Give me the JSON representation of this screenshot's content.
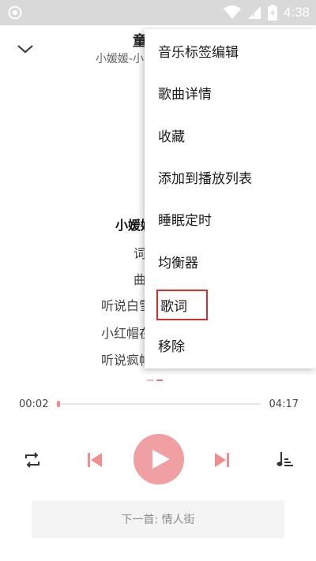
{
  "status_bar": {
    "time": "4:38"
  },
  "player": {
    "title": "童",
    "artist": "小媛媛-小",
    "lyrics": [
      {
        "text": "小媛媛",
        "active": true
      },
      {
        "text": "词",
        "active": false
      },
      {
        "text": "曲",
        "active": false
      },
      {
        "text": "听说白雪",
        "active": false
      },
      {
        "text": "小红帽在",
        "active": false
      },
      {
        "text": "听说疯帽",
        "active": false
      }
    ],
    "current_time": "00:02",
    "total_time": "04:17",
    "progress": 0.008,
    "next_song": "下一首: 情人街"
  },
  "menu": {
    "items": [
      {
        "label": "音乐标签编辑"
      },
      {
        "label": "歌曲详情"
      },
      {
        "label": "收藏"
      },
      {
        "label": "添加到播放列表"
      },
      {
        "label": "睡眠定时"
      },
      {
        "label": "均衡器"
      },
      {
        "label": "歌词",
        "highlighted": true
      },
      {
        "label": "移除"
      }
    ]
  },
  "colors": {
    "accent": "#f0a0a2",
    "accent_dark": "#e57373",
    "highlight_border": "#d32f2f",
    "status_bar": "#d9d9d9"
  },
  "icons": {
    "collapse": "chevron-down-icon",
    "repeat": "repeat-icon",
    "previous": "skip-previous-icon",
    "play": "play-icon",
    "next": "skip-next-icon",
    "playlist": "playlist-icon"
  }
}
